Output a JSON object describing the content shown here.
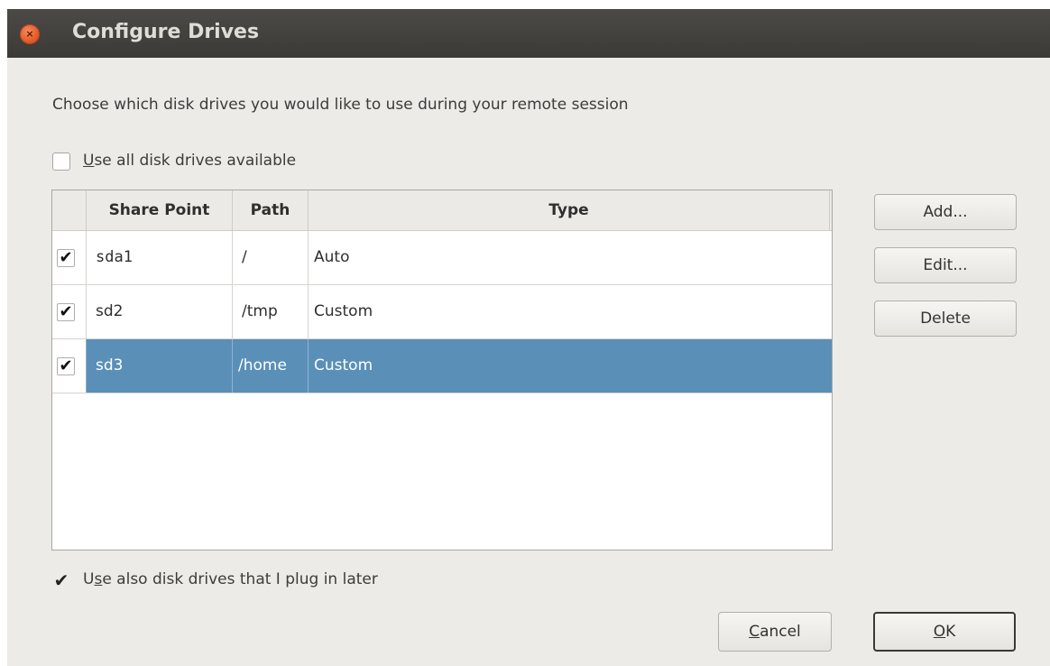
{
  "window": {
    "title": "Configure Drives",
    "close_glyph": "×"
  },
  "description": "Choose which disk drives you would like to use during your remote session",
  "use_all": {
    "label_mnemonic": "U",
    "label_rest": "se all disk drives available",
    "checked": false
  },
  "table": {
    "columns": [
      "Share Point",
      "Path",
      "Type"
    ],
    "rows": [
      {
        "checked": "✔",
        "share_point": "sda1",
        "path": "/",
        "type": "Auto",
        "selected": false
      },
      {
        "checked": "✔",
        "share_point": "sd2",
        "path": "/tmp",
        "type": "Custom",
        "selected": false
      },
      {
        "checked": "✔",
        "share_point": "sd3",
        "path": "/home",
        "type": "Custom",
        "selected": true
      }
    ]
  },
  "side_buttons": {
    "add": "Add...",
    "edit": "Edit...",
    "delete": "Delete"
  },
  "plug_later": {
    "check": "✔",
    "label_pre": "U",
    "label_mnemonic": "s",
    "label_rest": "e also disk drives that I plug in later",
    "checked": true
  },
  "footer": {
    "cancel_mnemonic": "C",
    "cancel_rest": "ancel",
    "ok_mnemonic": "O",
    "ok_rest": "K"
  },
  "colors": {
    "titlebar": "#3b3a37",
    "background": "#ecebe8",
    "selection": "#5a8fb8",
    "close": "#e0521f"
  }
}
